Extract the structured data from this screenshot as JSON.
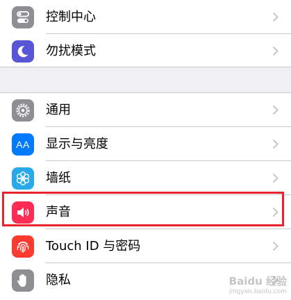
{
  "groups": [
    {
      "items": [
        {
          "label": "控制中心",
          "icon": "control-center-icon",
          "color": "#8e8e93"
        },
        {
          "label": "勿扰模式",
          "icon": "moon-icon",
          "color": "#5856d6"
        }
      ]
    },
    {
      "items": [
        {
          "label": "通用",
          "icon": "gear-icon",
          "color": "#8e8e93"
        },
        {
          "label": "显示与亮度",
          "icon": "text-size-icon",
          "color": "#007aff"
        },
        {
          "label": "墙纸",
          "icon": "wallpaper-flower-icon",
          "color": "#2aa9ea"
        },
        {
          "label": "声音",
          "icon": "speaker-icon",
          "color": "#ff2d55",
          "highlighted": true
        },
        {
          "label": "Touch ID 与密码",
          "icon": "fingerprint-icon",
          "color": "#ff3b30"
        },
        {
          "label": "隐私",
          "icon": "hand-icon",
          "color": "#8e8e93"
        }
      ]
    }
  ],
  "icon_texts": {
    "display_aa": "AA"
  },
  "highlight_color": "#e8232c",
  "watermark": {
    "text": "Baidu 经验",
    "subtext": "jingyan.baidu.com"
  }
}
